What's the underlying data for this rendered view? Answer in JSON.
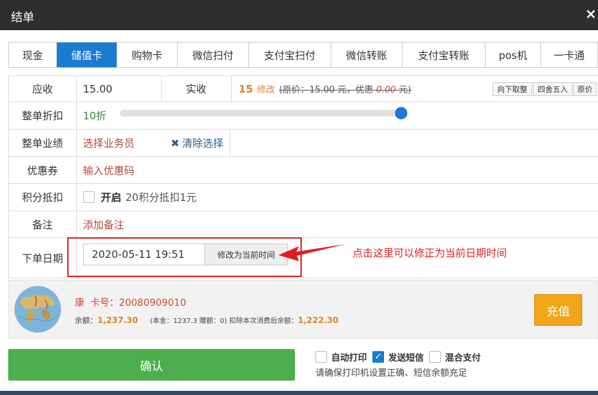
{
  "window": {
    "title": "结单",
    "close": "×"
  },
  "tabs": [
    {
      "label": "现金",
      "active": false
    },
    {
      "label": "储值卡",
      "active": true
    },
    {
      "label": "购物卡",
      "active": false
    },
    {
      "label": "微信扫付",
      "active": false
    },
    {
      "label": "支付宝扫付",
      "active": false
    },
    {
      "label": "微信转账",
      "active": false
    },
    {
      "label": "支付宝转账",
      "active": false
    },
    {
      "label": "pos机",
      "active": false
    },
    {
      "label": "一卡通",
      "active": false
    }
  ],
  "receivable": {
    "label": "应收",
    "value": "15.00"
  },
  "actual": {
    "label": "实收",
    "value": "15",
    "modify": "修改",
    "detail_prefix": "(原价：15.00 元，优惠 ",
    "detail_discount": "0.00",
    "detail_suffix": " 元)",
    "buttons": [
      "向下取整",
      "四舍五入",
      "原价"
    ]
  },
  "discount": {
    "label": "整单折扣",
    "value": "10折",
    "slider_fraction": 1.0
  },
  "performance": {
    "label": "整单业绩",
    "select": "选择业务员",
    "clear": "清除选择"
  },
  "coupon": {
    "label": "优惠券",
    "input": "输入优惠码"
  },
  "points": {
    "label": "积分抵扣",
    "enable": "开启",
    "rule": "20积分抵扣1元"
  },
  "remark": {
    "label": "备注",
    "add": "添加备注"
  },
  "order_date": {
    "label": "下单日期",
    "value": "2020-05-11 19:51",
    "button": "修改为当前时间"
  },
  "annotation": "点击这里可以修正为当前日期时间",
  "member": {
    "name": "康",
    "card_label": "卡号：",
    "card_no": "20080909010",
    "balance_label": "余额：",
    "balance": "1,237.30",
    "detail": "(本金：1237.3 赠额：0) 扣除本次消费后余额：",
    "after_balance": "1,222.30",
    "recharge": "充值"
  },
  "confirm": "确认",
  "options": [
    {
      "label": "自动打印",
      "checked": false
    },
    {
      "label": "发送短信",
      "checked": true
    },
    {
      "label": "混合支付",
      "checked": false
    }
  ],
  "hint": "请确保打印机设置正确、短信余额充足",
  "colors": {
    "accent": "#1a7bd1",
    "confirm": "#4cae4c",
    "recharge": "#f3a51a",
    "annotation": "#e0201e"
  }
}
